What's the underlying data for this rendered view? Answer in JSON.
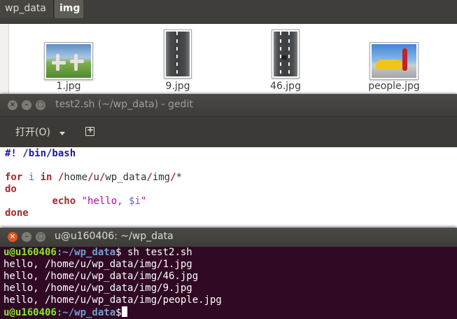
{
  "file_manager": {
    "breadcrumbs": [
      "wp_data",
      "img"
    ],
    "files": [
      {
        "name": "1.jpg",
        "thumb_icon": "yoga-photo-icon"
      },
      {
        "name": "9.jpg",
        "thumb_icon": "road-photo-icon"
      },
      {
        "name": "46.jpg",
        "thumb_icon": "road-car-photo-icon"
      },
      {
        "name": "people.jpg",
        "thumb_icon": "car-person-photo-icon"
      }
    ]
  },
  "gedit": {
    "title": "test2.sh (~/wp_data) - gedit",
    "open_label": "打开(O)",
    "new_tab_icon": "new-tab-icon",
    "code": {
      "shebang": "#! /bin/bash",
      "for_kw": "for",
      "for_var": "i",
      "in_kw": "in",
      "path": [
        "/",
        "home",
        "/",
        "u",
        "/",
        "wp_data",
        "/",
        "img",
        "/",
        "*"
      ],
      "do_kw": "do",
      "echo_kw": "echo",
      "echo_str_prefix": "\"hello, ",
      "echo_var": "$i",
      "echo_str_suffix": "\"",
      "done_kw": "done"
    }
  },
  "terminal": {
    "title": "u@u160406: ~/wp_data",
    "prompt_user": "u@u160406",
    "prompt_path": ":~/wp_data",
    "prompt_symbol": "$",
    "command": " sh test2.sh",
    "output": [
      "hello, /home/u/wp_data/img/1.jpg",
      "hello, /home/u/wp_data/img/46.jpg",
      "hello, /home/u/wp_data/img/9.jpg",
      "hello, /home/u/wp_data/img/people.jpg"
    ]
  },
  "colors": {
    "accent_close": "#e95420",
    "terminal_bg": "#300a24",
    "prompt_user": "#8ae234",
    "prompt_path": "#729fcf"
  }
}
